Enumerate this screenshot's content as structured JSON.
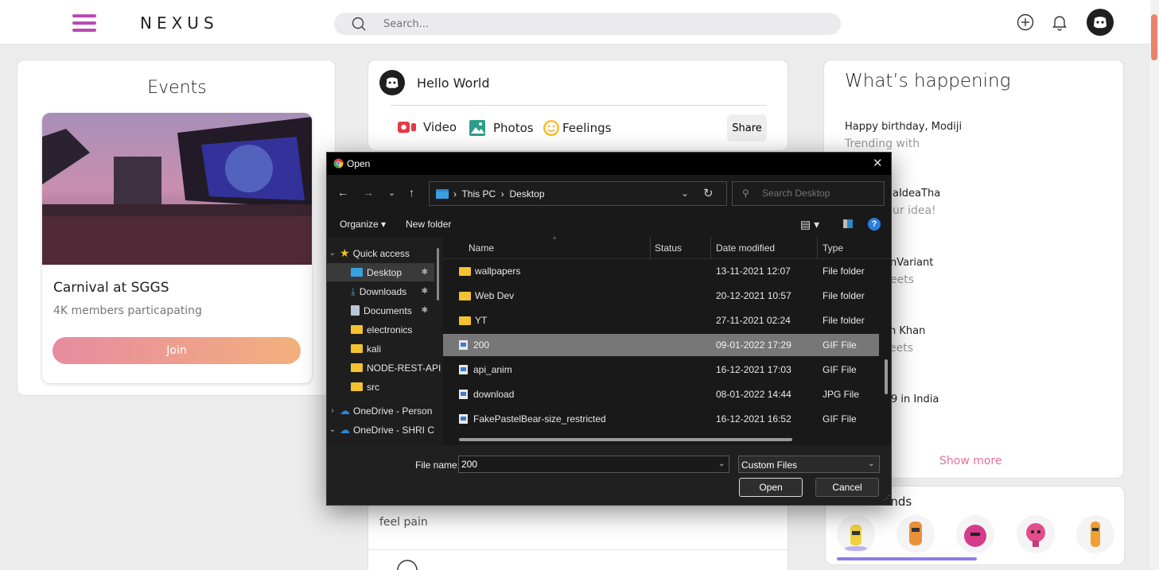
{
  "app": {
    "logo": "NEXUS",
    "search_placeholder": "Search..."
  },
  "events": {
    "title": "Events",
    "event_name": "Carnival at SGGS",
    "event_sub": "4K members particapating",
    "join_label": "Join"
  },
  "post": {
    "greeting": "Hello World",
    "actions": [
      "Video",
      "Photos",
      "Feelings"
    ],
    "share_label": "Share"
  },
  "feed": {
    "text": "feel pain"
  },
  "happening": {
    "title": "What’s happening",
    "items": [
      {
        "line1": "Happy birthday, Modiji",
        "line2": "Trending with"
      },
      {
        "line1": "aIdeaTha",
        "line2": "ur idea!"
      },
      {
        "line1": "nVariant",
        "line2": "eets"
      },
      {
        "line1": "n Khan",
        "line2": "eets"
      },
      {
        "line1": "9 in India",
        "line2": ""
      }
    ],
    "show_more": "Show more"
  },
  "friends": {
    "title": "iends"
  },
  "dialog": {
    "title": "Open",
    "close": "✕",
    "path": [
      "This PC",
      "Desktop"
    ],
    "search_placeholder": "Search Desktop",
    "organize": "Organize ▾",
    "new_folder": "New folder",
    "help": "?",
    "nav_items": [
      {
        "label": "Quick access",
        "chev": "⌄",
        "icon": "star-icon"
      },
      {
        "label": "Desktop",
        "icon": "desktop-icon",
        "pin": true
      },
      {
        "label": "Downloads",
        "icon": "download-icon",
        "pin": true
      },
      {
        "label": "Documents",
        "icon": "document-icon",
        "pin": true
      },
      {
        "label": "electronics",
        "icon": "folder-icon"
      },
      {
        "label": "kali",
        "icon": "folder-icon"
      },
      {
        "label": "NODE-REST-API",
        "icon": "folder-icon"
      },
      {
        "label": "src",
        "icon": "folder-icon"
      },
      {
        "label": "OneDrive - Person",
        "chev": "›",
        "icon": "cloud-icon"
      },
      {
        "label": "OneDrive - SHRI C",
        "chev": "⌄",
        "icon": "cloud-icon"
      }
    ],
    "columns": [
      "Name",
      "Status",
      "Date modified",
      "Type"
    ],
    "files": [
      {
        "name": "wallpapers",
        "date": "13-11-2021 12:07",
        "type": "File folder",
        "kind": "folder"
      },
      {
        "name": "Web Dev",
        "date": "20-12-2021 10:57",
        "type": "File folder",
        "kind": "folder"
      },
      {
        "name": "YT",
        "date": "27-11-2021 02:24",
        "type": "File folder",
        "kind": "folder"
      },
      {
        "name": "200",
        "date": "09-01-2022 17:29",
        "type": "GIF File",
        "kind": "file"
      },
      {
        "name": "api_anim",
        "date": "16-12-2021 17:03",
        "type": "GIF File",
        "kind": "file"
      },
      {
        "name": "download",
        "date": "08-01-2022 14:44",
        "type": "JPG File",
        "kind": "file"
      },
      {
        "name": "FakePastelBear-size_restricted",
        "date": "16-12-2021 16:52",
        "type": "GIF File",
        "kind": "file"
      }
    ],
    "selected_file": "200",
    "file_name_label": "File name:",
    "file_name_value": "200",
    "file_type": "Custom Files",
    "open_label": "Open",
    "cancel_label": "Cancel"
  },
  "colors": {
    "accent": "#b84bb2",
    "join_gradient_start": "#e78ba0",
    "join_gradient_end": "#f3b07d",
    "show_more": "#e0729a",
    "dialog_bg": "#1e1e1e",
    "dialog_selected_row": "#777777"
  }
}
